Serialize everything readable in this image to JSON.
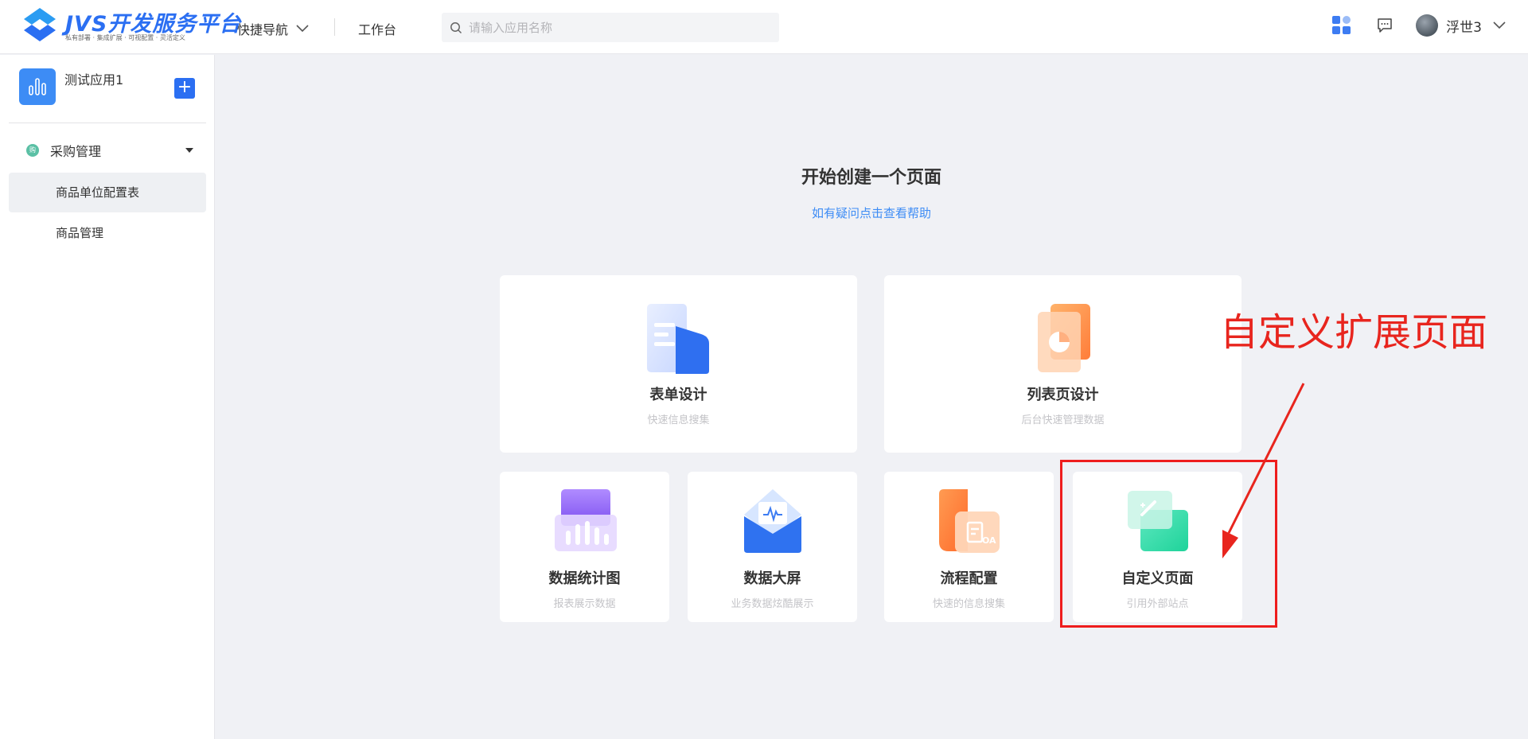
{
  "header": {
    "logo_text": "JVS开发服务平台",
    "logo_subtitle": "私有部署 · 集成扩展 · 可视配置 · 灵活定义",
    "quick_nav": "快捷导航",
    "workbench": "工作台",
    "search_placeholder": "请输入应用名称",
    "username": "浮世3",
    "icons": [
      "apps-grid-icon",
      "message-icon",
      "avatar",
      "chevron-down-icon"
    ]
  },
  "sidebar": {
    "app_name": "测试应用1",
    "add_label": "+",
    "group": {
      "label": "采购管理",
      "icon_text": "购"
    },
    "items": [
      {
        "label": "商品单位配置表",
        "active": true
      },
      {
        "label": "商品管理",
        "active": false
      }
    ]
  },
  "main": {
    "title": "开始创建一个页面",
    "help": "如有疑问点击查看帮助",
    "cards": [
      {
        "title": "表单设计",
        "desc": "快速信息搜集",
        "icon": "form-design-icon"
      },
      {
        "title": "列表页设计",
        "desc": "后台快速管理数据",
        "icon": "list-design-icon"
      },
      {
        "title": "数据统计图",
        "desc": "报表展示数据",
        "icon": "chart-icon"
      },
      {
        "title": "数据大屏",
        "desc": "业务数据炫酷展示",
        "icon": "big-screen-icon"
      },
      {
        "title": "流程配置",
        "desc": "快速的信息搜集",
        "icon": "workflow-icon"
      },
      {
        "title": "自定义页面",
        "desc": "引用外部站点",
        "icon": "custom-page-icon"
      }
    ]
  },
  "annotation": {
    "text": "自定义扩展页面",
    "color": "#e8251e"
  },
  "colors": {
    "brand": "#2b6ff2",
    "link": "#3d8cf5",
    "background": "#f0f1f5"
  }
}
